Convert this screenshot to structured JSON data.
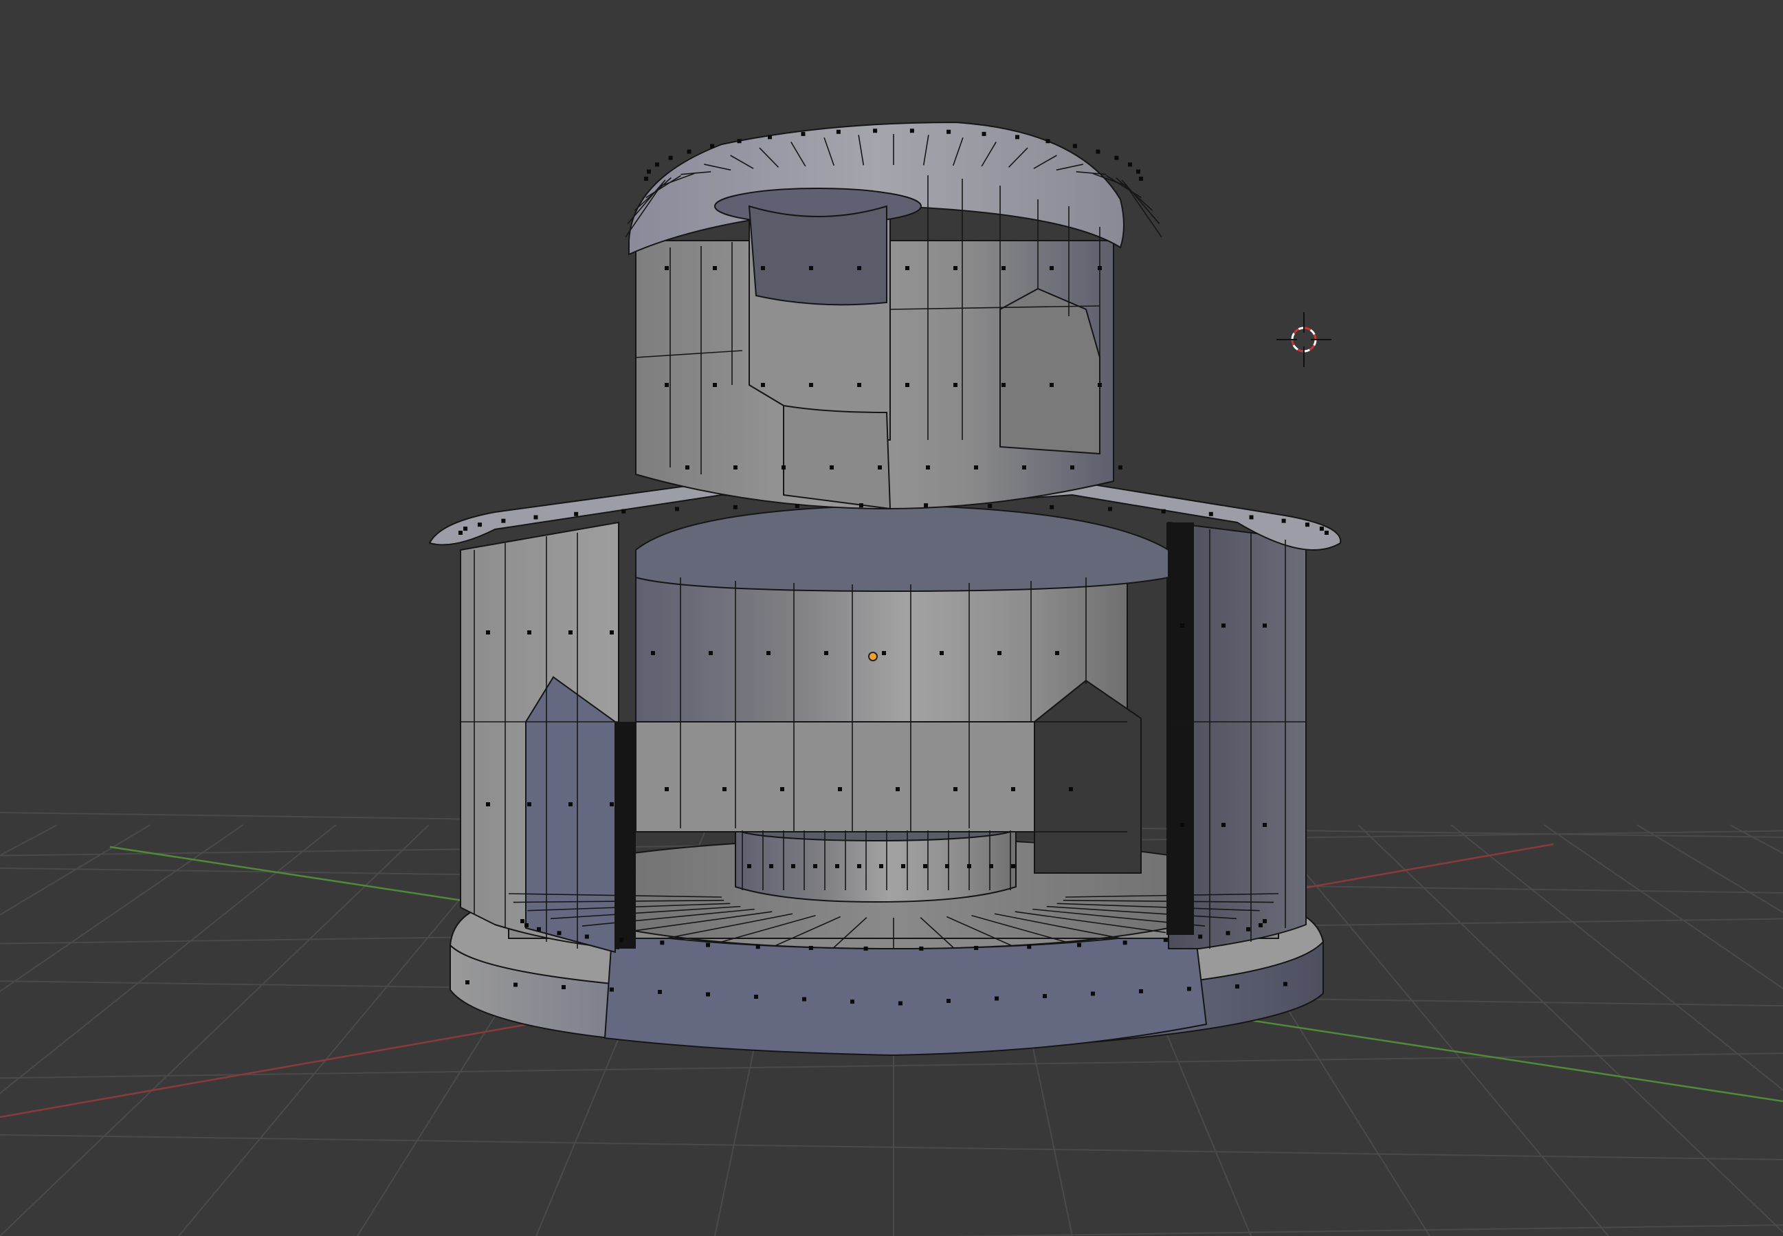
{
  "app": "3D viewport",
  "viewport": {
    "background_color": "#393939",
    "grid_color": "#4a4a4a",
    "x_axis_color": "#8a3a3a",
    "y_axis_color": "#4f8a3a",
    "mode": "edit-mode",
    "display": "solid-shading-with-wireframe",
    "show_face_dots": true
  },
  "scene": {
    "object_icon": "mesh-icon",
    "object_shape": "domed-tower-model",
    "face_color_light": "#a8a8a8",
    "face_color_mid": "#8c8c8c",
    "face_color_dark": "#5d5f6e",
    "wire_color": "#111111",
    "dot_color": "#0a0a0a",
    "origin_icon": "object-origin-icon",
    "origin_color": "#f0a030",
    "cursor_icon": "3d-cursor-icon",
    "cursor_colors": [
      "#cc3333",
      "#ffffff"
    ]
  }
}
